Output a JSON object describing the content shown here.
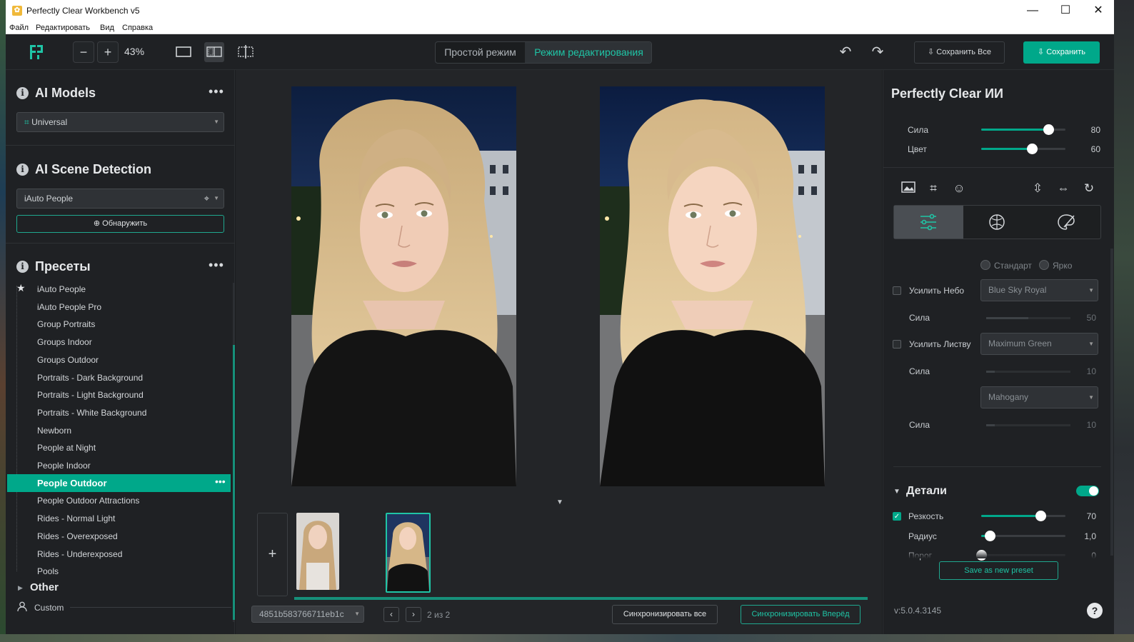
{
  "window": {
    "title": "Perfectly Clear Workbench v5",
    "app_icon": "PC"
  },
  "menu": [
    "Файл",
    "Редактировать",
    "Вид",
    "Справка"
  ],
  "toolbar": {
    "zoom": "43%",
    "mode_simple": "Простой режим",
    "mode_edit": "Режим редактирования",
    "save_all": "Сохранить Все",
    "save": "Сохранить"
  },
  "left": {
    "ai_models": {
      "title": "AI Models",
      "selected": "Universal"
    },
    "scene": {
      "title": "AI Scene Detection",
      "selected": "iAuto People",
      "detect_label": "Обнаружить"
    },
    "presets": {
      "title": "Пресеты",
      "items": [
        "iAuto People",
        "iAuto People Pro",
        "Group Portraits",
        "Groups Indoor",
        "Groups Outdoor",
        "Portraits - Dark Background",
        "Portraits - Light Background",
        "Portraits - White Background",
        "Newborn",
        "People at Night",
        "People Indoor",
        "People Outdoor",
        "People Outdoor Attractions",
        "Rides - Normal Light",
        "Rides - Overexposed",
        "Rides - Underexposed",
        "Pools"
      ],
      "selected_index": 11,
      "other": "Other",
      "custom": "Custom"
    }
  },
  "center": {
    "filename": "4851b583766711eb1c",
    "page": "2 из 2",
    "sync_all": "Синхронизировать все",
    "sync_forward": "Синхронизировать Вперёд"
  },
  "right": {
    "title": "Perfectly Clear ИИ",
    "strength": {
      "label": "Сила",
      "value": "80",
      "fraction": 0.8
    },
    "color": {
      "label": "Цвет",
      "value": "60",
      "fraction": 0.6
    },
    "radio_standard": "Стандарт",
    "radio_bright": "Ярко",
    "sky": {
      "label": "Усилить Небо",
      "preset": "Blue Sky Royal",
      "strength_label": "Сила",
      "strength": "50",
      "fraction": 0.5
    },
    "foliage": {
      "label": "Усилить Листву",
      "preset": "Maximum Green",
      "strength_label": "Сила",
      "strength": "10",
      "fraction": 0.1
    },
    "third": {
      "preset": "Mahogany",
      "strength_label": "Сила",
      "strength": "10",
      "fraction": 0.1
    },
    "details": {
      "title": "Детали",
      "sharpness": {
        "label": "Резкость",
        "value": "70",
        "fraction": 0.7
      },
      "radius": {
        "label": "Радиус",
        "value": "1,0",
        "fraction": 0.1
      },
      "threshold": {
        "label": "Порог",
        "value": "0",
        "fraction": 0.0
      }
    },
    "save_preset": "Save as new preset",
    "version": "v:5.0.4.3145",
    "help": "?"
  },
  "colors": {
    "accent": "#00a88a",
    "bg": "#1b1d1f",
    "panel": "#1f2124"
  }
}
